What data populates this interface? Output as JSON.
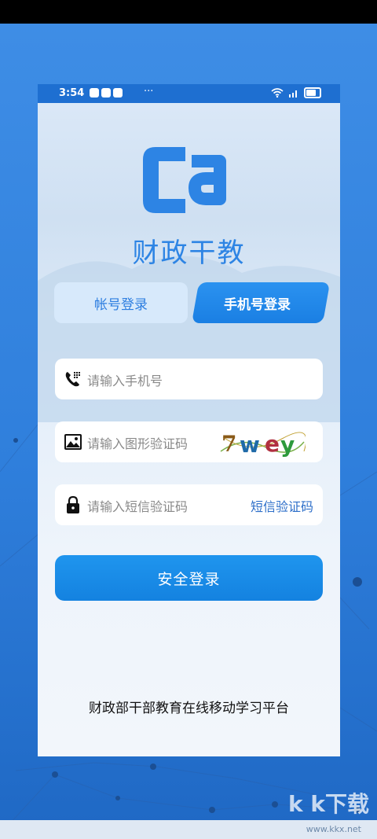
{
  "status_bar": {
    "time": "3:54",
    "more": "···"
  },
  "brand": {
    "name": "财政干教"
  },
  "tabs": [
    {
      "label": "帐号登录",
      "active": false
    },
    {
      "label": "手机号登录",
      "active": true
    }
  ],
  "form": {
    "phone_placeholder": "请输入手机号",
    "captcha_placeholder": "请输入图形验证码",
    "captcha_text": "7wey",
    "sms_placeholder": "请输入短信验证码",
    "sms_link": "短信验证码",
    "login_button": "安全登录"
  },
  "footer": {
    "text": "财政部干部教育在线移动学习平台"
  },
  "watermark": {
    "text": "k k下载",
    "url_text": "www.kkx.net"
  },
  "colors": {
    "accent": "#1a86e6",
    "link": "#2e6fc9",
    "brand": "#2d84e4"
  }
}
